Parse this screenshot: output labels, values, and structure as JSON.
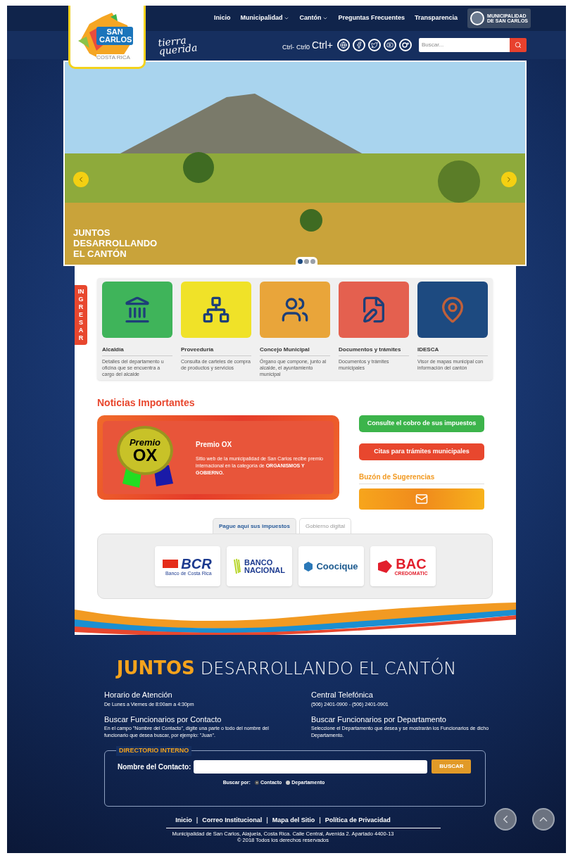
{
  "header": {
    "logo": {
      "name": "SAN CARLOS",
      "country": "COSTA RICA"
    },
    "nav": [
      {
        "label": "Inicio",
        "dropdown": false
      },
      {
        "label": "Municipalidad",
        "dropdown": true
      },
      {
        "label": "Cantón",
        "dropdown": true
      },
      {
        "label": "Preguntas Frecuentes",
        "dropdown": false
      },
      {
        "label": "Transparencia",
        "dropdown": false
      }
    ],
    "badge": [
      "MUNICIPALIDAD",
      "DE SAN CARLOS"
    ],
    "tagline": [
      "tierra",
      "querida"
    ],
    "font_controls": [
      "Ctrl-",
      "Ctrl0",
      "Ctrl+"
    ],
    "search": {
      "placeholder": "Buscar..."
    }
  },
  "slider": {
    "caption": [
      "JUNTOS",
      "DESARROLLANDO",
      "EL CANTÓN"
    ],
    "dots": [
      {
        "selected": true
      },
      {
        "selected": false
      },
      {
        "selected": false
      }
    ]
  },
  "ingresar": "INGRESAR",
  "services": [
    {
      "title": "Alcaldía",
      "description": "Detalles del departamento u oficina que se encuentra a cargo del alcalde",
      "color": "#3fb45a",
      "kind": "building"
    },
    {
      "title": "Proveeduría",
      "description": "Consulta de carteles de compra de productos y servicios",
      "color": "#f0e228",
      "kind": "network"
    },
    {
      "title": "Concejo Municipal",
      "description": "Órgano que compone, junto al alcalde, el ayuntamiento municipal",
      "color": "#e9a53a",
      "kind": "people"
    },
    {
      "title": "Documentos y trámites",
      "description": "Documentos y trámites municipales",
      "color": "#e4604f",
      "kind": "document"
    },
    {
      "title": "IDESCA",
      "description": "Visor de mapas municipal con información del cantón",
      "color": "#1d4a80",
      "kind": "map"
    }
  ],
  "news": {
    "heading": "Noticias Importantes",
    "seal": [
      "Premio",
      "OX"
    ],
    "title": "Premio OX",
    "text": "Sitio web de la municipalidad de San Carlos recibe premio internacional en la categoría de **ORGANISMOS Y GOBIERNO.**"
  },
  "quick_links": [
    {
      "label": "Consulte el cobro de sus impuestos",
      "color": "#3cb44b"
    },
    {
      "label": "Citas para trámites municipales",
      "color": "#e8472e"
    }
  ],
  "suggestions": {
    "heading": "Buzón de Sugerencias"
  },
  "payment_tabs": [
    {
      "label": "Pague aquí sus impuestos",
      "selected": true
    },
    {
      "label": "Gobierno digital",
      "selected": false
    }
  ],
  "banks": [
    {
      "kind": "bcr",
      "name": "BCR",
      "sub": "Banco de Costa Rica"
    },
    {
      "kind": "bn",
      "name": "BANCO",
      "sub": "NACIONAL"
    },
    {
      "kind": "coocique",
      "name": "Coocique"
    },
    {
      "kind": "bac",
      "name": "BAC",
      "sub": "CREDOMATIC"
    }
  ],
  "footer": {
    "title": [
      "JUNTOS",
      "DESARROLLANDO EL CANTÓN"
    ],
    "info": [
      {
        "heading": "Horario de Atención",
        "text": "De Lunes a Viernes de 8:00am a 4:30pm"
      },
      {
        "heading": "Central Telefónica",
        "text": "(506) 2401-0900 - (506) 2401-0901"
      },
      {
        "heading": "Buscar Funcionarios por Contacto",
        "text": "En el campo \"Nombre del Contacto\", digite una parte o todo del nombre del funcionario que desea buscar, por ejemplo: \"Juan\"."
      },
      {
        "heading": "Buscar Funcionarios por Departamento",
        "text": "Seleccione el Departamento que desea y se mostrarán los Funcionarios de dicho Departamento."
      }
    ],
    "directory": {
      "legend": "DIRECTORIO INTERNO",
      "field_label": "Nombre del Contacto:",
      "button": "BUSCAR",
      "search_by": "Buscar por:",
      "options": [
        {
          "label": "Contacto",
          "selected": true
        },
        {
          "label": "Departamento",
          "selected": false
        }
      ]
    },
    "link_separator": "|",
    "links": [
      "Inicio",
      "Correo Institucional",
      "Mapa del Sitio",
      "Política de Privacidad"
    ],
    "address": "Municipalidad de San Carlos, Alajuela, Costa Rica. Calle Central, Avenida 2. Apartado 4400-13",
    "copyright": "© 2018 Todos los derechos reservados"
  }
}
